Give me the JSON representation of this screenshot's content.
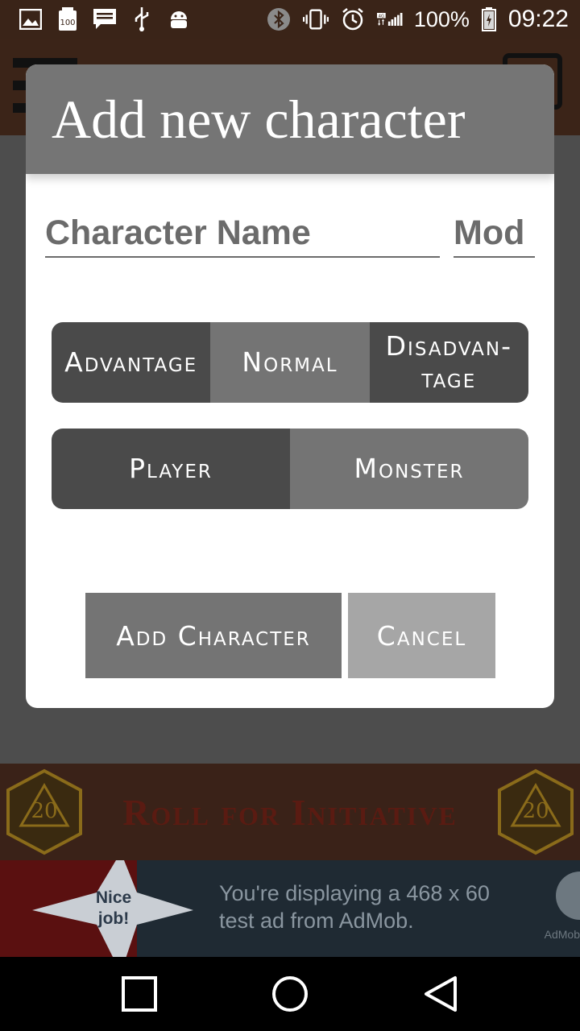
{
  "status_bar": {
    "battery": "100%",
    "time": "09:22",
    "network": "4G"
  },
  "dialog": {
    "title": "Add new character",
    "name_placeholder": "Character Name",
    "mod_placeholder": "Mod",
    "roll_modes": [
      "Advantage",
      "Normal",
      "Disadvan-\ntage"
    ],
    "selected_roll_mode": "Normal",
    "character_types": [
      "Player",
      "Monster"
    ],
    "selected_character_type": "Monster",
    "add_label": "Add Character",
    "cancel_label": "Cancel"
  },
  "banner": {
    "title": "Roll for Initiative",
    "die_label": "20"
  },
  "ad": {
    "badge": "Nice\njob!",
    "line1": "You're displaying a 468 x 60",
    "line2": "test ad from AdMob.",
    "brand": "AdMob"
  },
  "colors": {
    "dialog_header": "#757575",
    "segment_dark": "#4a4a4a",
    "segment_mid": "#747474",
    "cancel": "#a6a6a6",
    "banner_text": "#5a1b12"
  }
}
